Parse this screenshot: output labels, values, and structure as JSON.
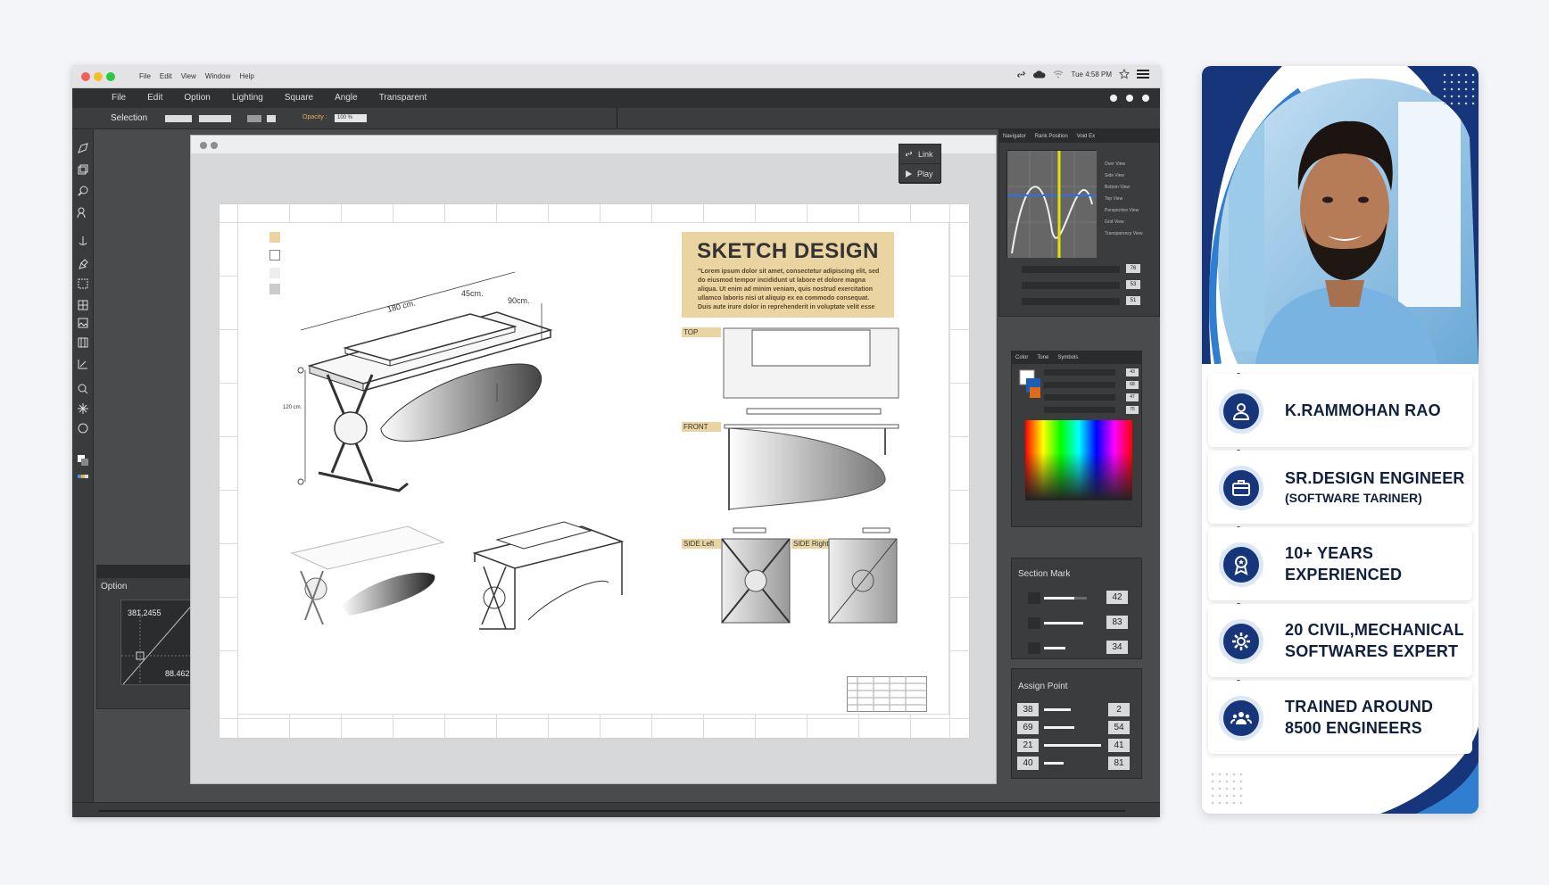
{
  "app": {
    "mac_menu": [
      "File",
      "Edit",
      "View",
      "Window",
      "Help"
    ],
    "clock": "Tue 4:58 PM",
    "app_menu": [
      "File",
      "Edit",
      "Option",
      "Lighting",
      "Square",
      "Angle",
      "Transparent"
    ],
    "selection_label": "Selection",
    "opacity_label": "Opacity :",
    "opacity_value": "100 %",
    "link_label": "Link",
    "play_label": "Play",
    "option_panel": {
      "title": "Option",
      "value1": "381,2455",
      "value2": "88.462"
    },
    "nav_tabs": [
      "Navigator",
      "Rank Position",
      "Void Ex"
    ],
    "nav_views": [
      "Over View",
      "Side View",
      "Bottom View",
      "Top View",
      "Perspective View",
      "Grid View",
      "Transparency View"
    ],
    "nav_values": [
      "76",
      "53",
      "51"
    ],
    "color_tabs": [
      "Color",
      "Tone",
      "Symbols"
    ],
    "color_values": [
      "43",
      "68",
      "47",
      "75"
    ],
    "section_mark": {
      "title": "Section Mark",
      "values": [
        "42",
        "83",
        "34"
      ]
    },
    "assign_point": {
      "title": "Assign Point",
      "left": [
        "38",
        "69",
        "21",
        "40"
      ],
      "right": [
        "2",
        "54",
        "41",
        "81"
      ]
    },
    "colors": {
      "accent": "#e0b24a",
      "tag_bg": "#ead4a1"
    }
  },
  "sheet": {
    "title": "SKETCH DESIGN",
    "body": "\"Lorem ipsum dolor sit amet, consectetur adipiscing elit, sed do eiusmod tempor incididunt ut labore et dolore magna aliqua. Ut enim ad minim veniam, quis nostrud exercitation ullamco laboris nisi ut aliquip ex ea commodo consequat. Duis aute irure dolor in reprehenderit in voluptate velit esse",
    "dims": {
      "length": "180 cm.",
      "depth": "45cm.",
      "width": "90cm.",
      "height": "120 cm."
    },
    "views": {
      "top": "TOP",
      "front": "FRONT",
      "side_left": "SIDE Left",
      "side_right": "SIDE Right"
    }
  },
  "profile": {
    "name": "K.RAMMOHAN RAO",
    "role_line1": "SR.DESIGN ENGINEER",
    "role_line2": "(SOFTWARE TARINER)",
    "experience_line1": "10+ YEARS",
    "experience_line2": "EXPERIENCED",
    "software_line1": "20 CIVIL,MECHANICAL",
    "software_line2": "SOFTWARES EXPERT",
    "trained_line1": "TRAINED AROUND",
    "trained_line2": "8500 ENGINEERS",
    "colors": {
      "navy": "#16357a",
      "blue": "#1f6fc2"
    }
  }
}
